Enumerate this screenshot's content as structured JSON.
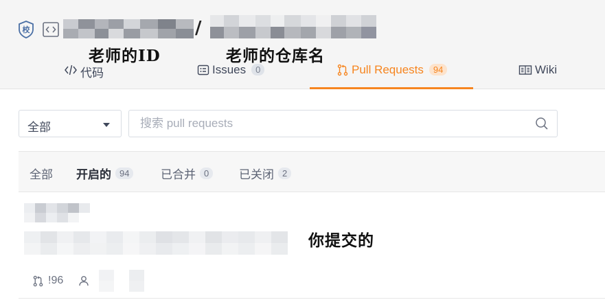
{
  "header": {
    "school_badge_text": "校",
    "slash": "/",
    "annotations": {
      "teacher_id": "老师的ID",
      "teacher_repo": "老师的仓库名"
    }
  },
  "tabs": [
    {
      "label": "代码",
      "icon": "code-icon"
    },
    {
      "label": "Issues",
      "count": "0",
      "icon": "issues-icon"
    },
    {
      "label": "Pull Requests",
      "count": "94",
      "icon": "pull-request-icon",
      "active": true
    },
    {
      "label": "Wiki",
      "icon": "wiki-icon"
    }
  ],
  "filter": {
    "select_value": "全部",
    "search_placeholder": "搜索 pull requests"
  },
  "states": [
    {
      "label": "全部"
    },
    {
      "label": "开启的",
      "count": "94",
      "active": true
    },
    {
      "label": "已合并",
      "count": "0"
    },
    {
      "label": "已关闭",
      "count": "2"
    }
  ],
  "pr_item": {
    "number": "!96",
    "annotation": "你提交的"
  },
  "colors": {
    "accent": "#f6851f",
    "header_bg": "#f5f5f5",
    "text": "#40485b"
  }
}
